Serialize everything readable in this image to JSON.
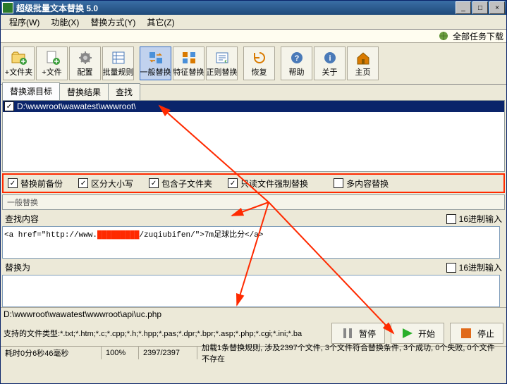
{
  "title": "超级批量文本替换  5.0",
  "menu": {
    "program": "程序(W)",
    "function": "功能(X)",
    "replace_mode": "替换方式(Y)",
    "other": "其它(Z)"
  },
  "download_all": "全部任务下载",
  "toolbar": {
    "add_folder": "+文件夹",
    "add_file": "+文件",
    "config": "配置",
    "batch_rules": "批量规则",
    "general_replace": "一般替换",
    "feature_replace": "特征替换",
    "regex_replace": "正则替换",
    "restore": "恢复",
    "help": "帮助",
    "about": "关于",
    "home": "主页"
  },
  "tabs": {
    "source": "替换源目标",
    "result": "替换结果",
    "find": "查找"
  },
  "path": "D:\\wwwroot\\wawatest\\wwwroot\\",
  "opts": {
    "backup": "替换前备份",
    "case": "区分大小写",
    "subfolder": "包含子文件夹",
    "readonly": "只读文件强制替换",
    "multi": "多内容替换"
  },
  "section_general": "一般替换",
  "find_label": "查找内容",
  "replace_label": "替换为",
  "hex_input": "16进制输入",
  "find_content_pre": "<a href=\"http://www.",
  "find_content_post": "/zuqiubifen/\">7m足球比分</a>",
  "current_file": "D:\\wwwroot\\wawatest\\wwwroot\\api\\uc.php",
  "supported_label": "支持的文件类型:",
  "supported_types": "*.txt;*.htm;*.c;*.cpp;*.h;*.hpp;*.pas;*.dpr;*.bpr;*.asp;*.php;*.cgi;*.ini;*.ba",
  "btns": {
    "pause": "暂停",
    "start": "开始",
    "stop": "停止"
  },
  "status": {
    "elapsed": "耗时0分6秒46毫秒",
    "progress": "100%",
    "count": "2397/2397",
    "summary": "加载1条替换规则, 涉及2397个文件, 3个文件符合替换条件, 3个成功, 0个失败, 0个文件不存在"
  }
}
